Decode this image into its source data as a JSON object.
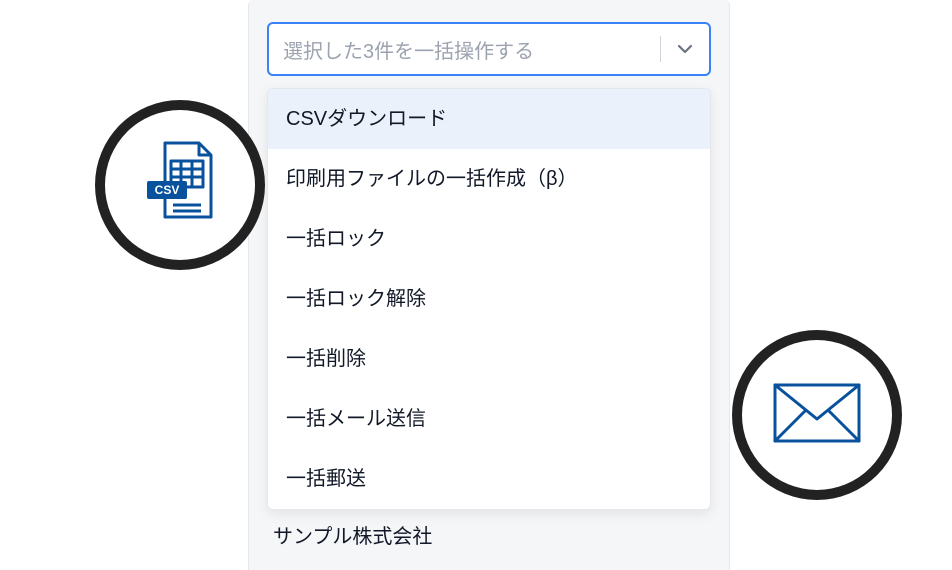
{
  "select": {
    "label": "選択した3件を一括操作する"
  },
  "dropdown": {
    "items": [
      {
        "label": "CSVダウンロード",
        "highlighted": true
      },
      {
        "label": "印刷用ファイルの一括作成（β）",
        "highlighted": false
      },
      {
        "label": "一括ロック",
        "highlighted": false
      },
      {
        "label": "一括ロック解除",
        "highlighted": false
      },
      {
        "label": "一括削除",
        "highlighted": false
      },
      {
        "label": "一括メール送信",
        "highlighted": false
      },
      {
        "label": "一括郵送",
        "highlighted": false
      }
    ]
  },
  "behind": {
    "text": "サンプル株式会社"
  },
  "colors": {
    "accent": "#08519c"
  }
}
